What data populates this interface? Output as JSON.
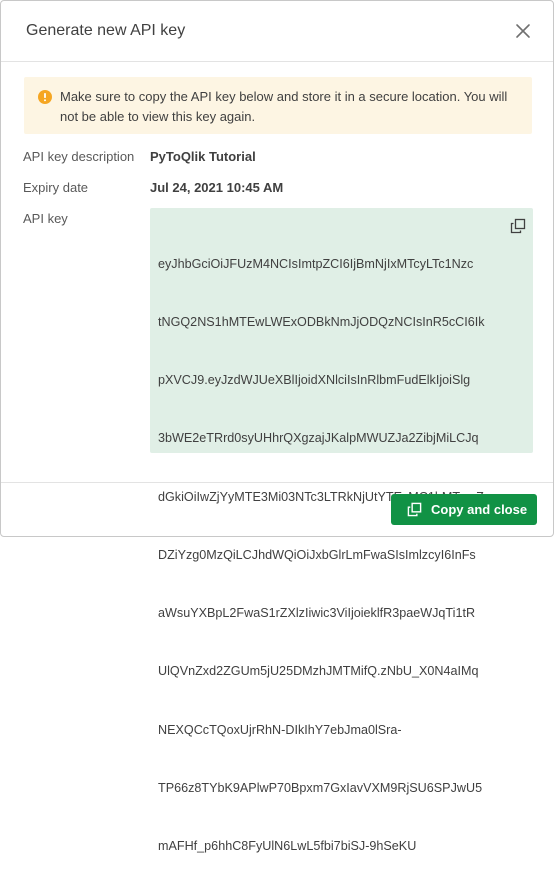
{
  "dialog": {
    "title": "Generate new API key",
    "close_icon": "close-icon"
  },
  "notice": {
    "icon": "warning-icon",
    "text": "Make sure to copy the API key below and store it in a secure location. You will not be able to view this key again.",
    "icon_color": "#f5a623",
    "background": "#fdf5e3"
  },
  "fields": {
    "description": {
      "label": "API key description",
      "value": "PyToQlik Tutorial"
    },
    "expiry": {
      "label": "Expiry date",
      "value": "Jul 24, 2021 10:45 AM"
    },
    "api_key": {
      "label": "API key",
      "lines": [
        "eyJhbGciOiJFUzM4NCIsImtpZCI6IjBmNjIxMTcyLTc1Nzc",
        "tNGQ2NS1hMTEwLWExODBkNmJjODQzNCIsInR5cCI6Ik",
        "pXVCJ9.eyJzdWJUeXBlIjoidXNlciIsInRlbmFudElkIjoiSlg",
        "3bWE2eTRrd0syUHhrQXgzajJKalpMWUZJa2ZibjMiLCJq",
        "dGkiOiIwZjYyMTE3Mi03NTc3LTRkNjUtYTExMC1hMTgwZ",
        "DZiYzg0MzQiLCJhdWQiOiJxbGlrLmFwaSIsImlzcyI6InFs",
        "aWsuYXBpL2FwaS1rZXlzIiwic3ViIjoieklfR3paeWJqTi1tR",
        "UlQVnZxd2ZGUm5jU25DMzhJMTMifQ.zNbU_X0N4aIMq",
        "NEXQCcTQoxUjrRhN-DIkIhY7ebJma0lSra-",
        "TP66z8TYbK9APlwP70Bpxm7GxIavVXM9RjSU6SPJwU5",
        "mAFHf_p6hhC8FyUlN6LwL5fbi7biSJ-9hSeKU"
      ],
      "copy_icon": "copy-icon",
      "background": "#e0efe6"
    }
  },
  "footer": {
    "primary_button": {
      "label": "Copy and close",
      "icon": "copy-icon",
      "color": "#119245"
    }
  }
}
